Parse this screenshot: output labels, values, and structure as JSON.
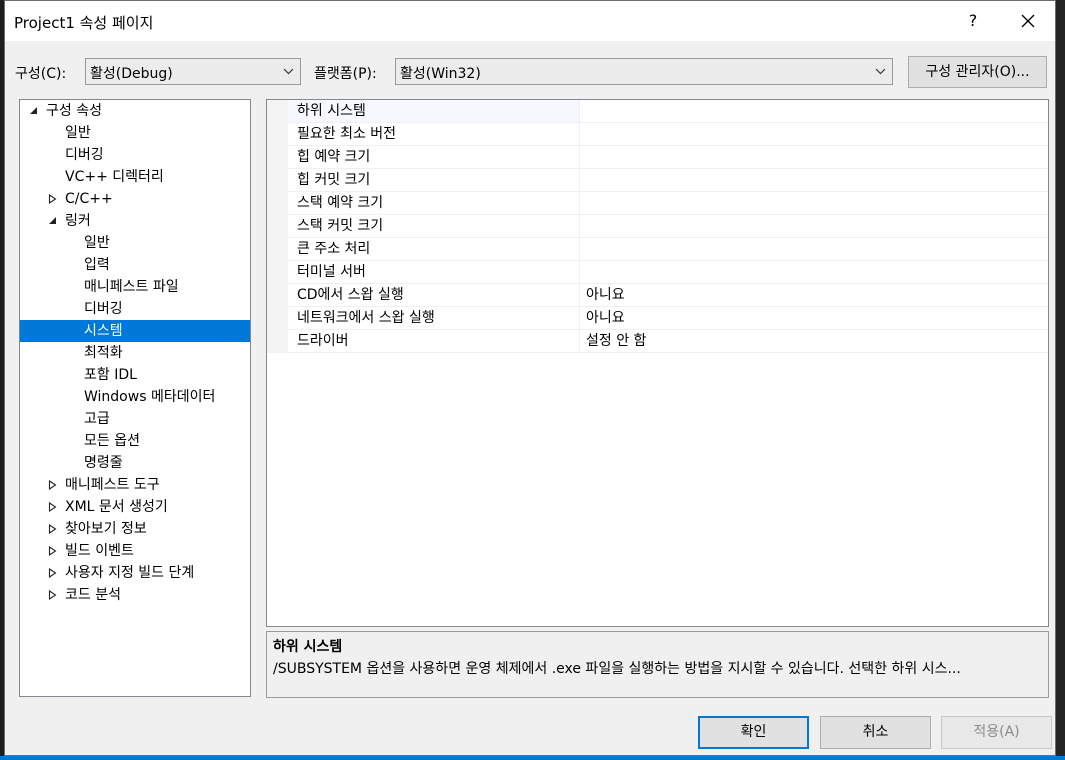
{
  "window": {
    "title": "Project1 속성 페이지",
    "help_label": "?"
  },
  "toolbar": {
    "config_label": "구성(C):",
    "config_value": "활성(Debug)",
    "platform_label": "플랫폼(P):",
    "platform_value": "활성(Win32)",
    "config_manager_label": "구성 관리자(O)..."
  },
  "tree": {
    "items": [
      {
        "label": "구성 속성",
        "expander": "expanded"
      },
      {
        "label": "일반"
      },
      {
        "label": "디버깅"
      },
      {
        "label": "VC++ 디렉터리"
      },
      {
        "label": "C/C++",
        "expander": "collapsed"
      },
      {
        "label": "링커",
        "expander": "expanded"
      },
      {
        "label": "일반"
      },
      {
        "label": "입력"
      },
      {
        "label": "매니페스트 파일"
      },
      {
        "label": "디버깅"
      },
      {
        "label": "시스템",
        "selected": true
      },
      {
        "label": "최적화"
      },
      {
        "label": "포함 IDL"
      },
      {
        "label": "Windows 메타데이터"
      },
      {
        "label": "고급"
      },
      {
        "label": "모든 옵션"
      },
      {
        "label": "명령줄"
      },
      {
        "label": "매니페스트 도구",
        "expander": "collapsed"
      },
      {
        "label": "XML 문서 생성기",
        "expander": "collapsed"
      },
      {
        "label": "찾아보기 정보",
        "expander": "collapsed"
      },
      {
        "label": "빌드 이벤트",
        "expander": "collapsed"
      },
      {
        "label": "사용자 지정 빌드 단계",
        "expander": "collapsed"
      },
      {
        "label": "코드 분석",
        "expander": "collapsed"
      }
    ]
  },
  "properties": {
    "rows": [
      {
        "name": "하위 시스템",
        "value": ""
      },
      {
        "name": "필요한 최소 버전",
        "value": ""
      },
      {
        "name": "힙 예약 크기",
        "value": ""
      },
      {
        "name": "힙 커밋 크기",
        "value": ""
      },
      {
        "name": "스택 예약 크기",
        "value": ""
      },
      {
        "name": "스택 커밋 크기",
        "value": ""
      },
      {
        "name": "큰 주소 처리",
        "value": ""
      },
      {
        "name": "터미널 서버",
        "value": ""
      },
      {
        "name": "CD에서 스왑 실행",
        "value": "아니요"
      },
      {
        "name": "네트워크에서 스왑 실행",
        "value": "아니요"
      },
      {
        "name": "드라이버",
        "value": "설정 안 함"
      }
    ]
  },
  "description": {
    "title": "하위 시스템",
    "text": "/SUBSYSTEM 옵션을 사용하면 운영 체제에서 .exe 파일을 실행하는 방법을 지시할 수 있습니다. 선택한 하위 시스..."
  },
  "buttons": {
    "ok": "확인",
    "cancel": "취소",
    "apply": "적용(A)"
  },
  "colors": {
    "selection": "#0078d7",
    "accent_border": "#0078d7",
    "disabled_text": "#8a8a8a"
  }
}
